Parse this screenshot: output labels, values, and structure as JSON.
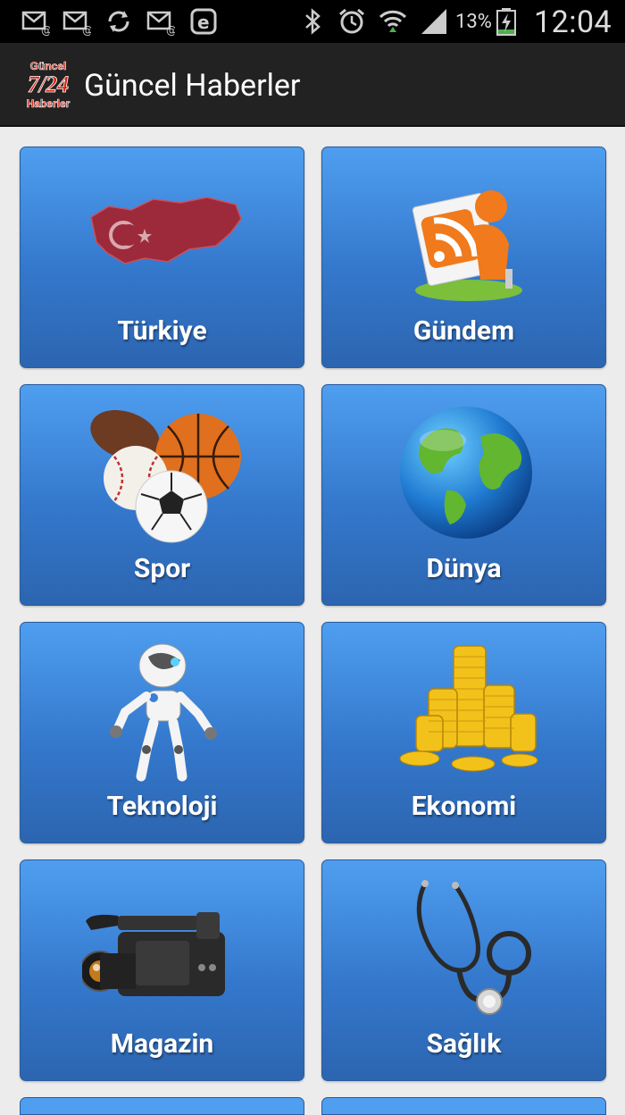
{
  "status_bar": {
    "icons_left": [
      "email-notification-icon",
      "email-notification-icon",
      "sync-icon",
      "email-notification-icon",
      "e-app-icon"
    ],
    "icons_right": [
      "bluetooth-icon",
      "alarm-icon",
      "wifi-icon",
      "signal-icon",
      "battery-charging-icon"
    ],
    "battery": "13%",
    "time": "12:04"
  },
  "app_bar": {
    "title": "Güncel Haberler",
    "logo_text_top": "Güncel",
    "logo_text_mid": "7/24",
    "logo_text_bottom": "Haberler"
  },
  "tiles": [
    {
      "label": "Türkiye",
      "icon": "turkey-map-icon"
    },
    {
      "label": "Gündem",
      "icon": "rss-reader-icon"
    },
    {
      "label": "Spor",
      "icon": "sports-balls-icon"
    },
    {
      "label": "Dünya",
      "icon": "globe-icon"
    },
    {
      "label": "Teknoloji",
      "icon": "robot-icon"
    },
    {
      "label": "Ekonomi",
      "icon": "gold-coins-icon"
    },
    {
      "label": "Magazin",
      "icon": "video-camera-icon"
    },
    {
      "label": "Sağlık",
      "icon": "stethoscope-icon"
    }
  ],
  "colors": {
    "tile_top": "#4f9ef0",
    "tile_bottom": "#2c65b0",
    "app_bar": "#222222",
    "status_bar": "#000000",
    "background": "#ececec"
  }
}
